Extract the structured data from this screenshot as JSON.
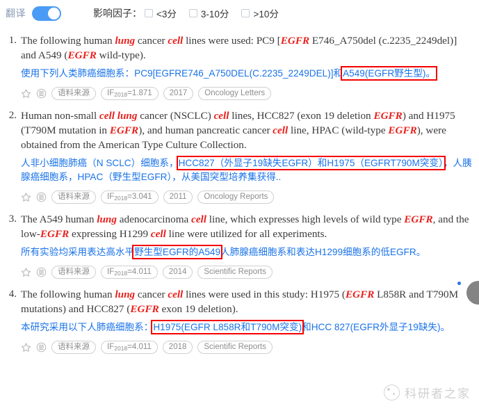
{
  "toolbar": {
    "translate_label": "翻译",
    "translate_enabled": "on",
    "impact_factor_label": "影响因子：",
    "filters": [
      {
        "label": "<3分",
        "checked": false
      },
      {
        "label": "3-10分",
        "checked": false
      },
      {
        "label": ">10分",
        "checked": false
      }
    ]
  },
  "results": [
    {
      "index": "1.",
      "en_parts": [
        {
          "t": "The following human ",
          "kw": false
        },
        {
          "t": "lung",
          "kw": true
        },
        {
          "t": " cancer ",
          "kw": false
        },
        {
          "t": "cell",
          "kw": true
        },
        {
          "t": " lines were used: PC9 [",
          "kw": false
        },
        {
          "t": "EGFR",
          "kw": true
        },
        {
          "t": " E746_A750del (c.2235_2249del)] and A549 (",
          "kw": false
        },
        {
          "t": "EGFR",
          "kw": true
        },
        {
          "t": " wild-type).",
          "kw": false
        }
      ],
      "zh_parts": [
        {
          "t": "使用下列人类肺癌细胞系：PC9[EGFRE746_A750DEL(C.2235_2249DEL)]和",
          "hl": false
        },
        {
          "t": "A549(EGFR野生型)。",
          "hl": true
        }
      ],
      "badges": {
        "source": "语料来源",
        "if_prefix": "IF",
        "if_year": "2018",
        "if_value": "=1.871",
        "year": "2017",
        "journal": "Oncology Letters"
      }
    },
    {
      "index": "2.",
      "en_parts": [
        {
          "t": "Human non-small ",
          "kw": false
        },
        {
          "t": "cell lung",
          "kw": true
        },
        {
          "t": " cancer (NSCLC) ",
          "kw": false
        },
        {
          "t": "cell",
          "kw": true
        },
        {
          "t": " lines, HCC827 (exon 19 deletion ",
          "kw": false
        },
        {
          "t": "EGFR",
          "kw": true
        },
        {
          "t": ") and H1975 (T790M mutation in ",
          "kw": false
        },
        {
          "t": "EGFR",
          "kw": true
        },
        {
          "t": "), and human pancreatic cancer ",
          "kw": false
        },
        {
          "t": "cell",
          "kw": true
        },
        {
          "t": " line, HPAC (wild-type ",
          "kw": false
        },
        {
          "t": "EGFR",
          "kw": true
        },
        {
          "t": "), were obtained from the American Type Culture Collection.",
          "kw": false
        }
      ],
      "zh_parts": [
        {
          "t": "人非小细胞肺癌（N SCLC）细胞系，",
          "hl": false
        },
        {
          "t": "HCC827（外显子19缺失EGFR）和H1975（EGFRT790M突变）",
          "hl": true
        },
        {
          "t": "，人胰腺癌细胞系，HPAC（野生型EGFR），从美国突型培养集获得..",
          "hl": false
        }
      ],
      "badges": {
        "source": "语料来源",
        "if_prefix": "IF",
        "if_year": "2018",
        "if_value": "=3.041",
        "year": "2011",
        "journal": "Oncology Reports"
      }
    },
    {
      "index": "3.",
      "en_parts": [
        {
          "t": "The A549 human ",
          "kw": false
        },
        {
          "t": "lung",
          "kw": true
        },
        {
          "t": " adenocarcinoma ",
          "kw": false
        },
        {
          "t": "cell",
          "kw": true
        },
        {
          "t": " line, which expresses high levels of wild type ",
          "kw": false
        },
        {
          "t": "EGFR",
          "kw": true
        },
        {
          "t": ", and the low-",
          "kw": false
        },
        {
          "t": "EGFR",
          "kw": true
        },
        {
          "t": " expressing H1299 ",
          "kw": false
        },
        {
          "t": "cell",
          "kw": true
        },
        {
          "t": " line were utilized for all experiments.",
          "kw": false
        }
      ],
      "zh_parts": [
        {
          "t": "所有实验均采用表达高水平",
          "hl": false
        },
        {
          "t": "野生型EGFR的A549",
          "hl": true
        },
        {
          "t": "人肺腺癌细胞系和表达H1299细胞系的低EGFR。",
          "hl": false
        }
      ],
      "badges": {
        "source": "语料来源",
        "if_prefix": "IF",
        "if_year": "2018",
        "if_value": "=4.011",
        "year": "2014",
        "journal": "Scientific Reports"
      }
    },
    {
      "index": "4.",
      "en_parts": [
        {
          "t": "The following human ",
          "kw": false
        },
        {
          "t": "lung",
          "kw": true
        },
        {
          "t": " cancer ",
          "kw": false
        },
        {
          "t": "cell",
          "kw": true
        },
        {
          "t": " lines were used in this study: H1975 (",
          "kw": false
        },
        {
          "t": "EGFR",
          "kw": true
        },
        {
          "t": " L858R and T790M mutations) and HCC827 (",
          "kw": false
        },
        {
          "t": "EGFR",
          "kw": true
        },
        {
          "t": " exon 19 deletion).",
          "kw": false
        }
      ],
      "zh_parts": [
        {
          "t": "本研究采用以下人肺癌细胞系：",
          "hl": false
        },
        {
          "t": "H1975(EGFR L858R和T790M突变)",
          "hl": true
        },
        {
          "t": "和HCC 827(EGFR外显子19缺失)。",
          "hl": false
        }
      ],
      "badges": {
        "source": "语料来源",
        "if_prefix": "IF",
        "if_year": "2018",
        "if_value": "=4.011",
        "year": "2018",
        "journal": "Scientific Reports"
      }
    }
  ],
  "watermark": {
    "text": "科研者之家"
  },
  "colors": {
    "accent_blue": "#4a9bf5",
    "translation_blue": "#1a73e8",
    "keyword_red": "#e8201b",
    "highlight_red": "#f50000"
  }
}
